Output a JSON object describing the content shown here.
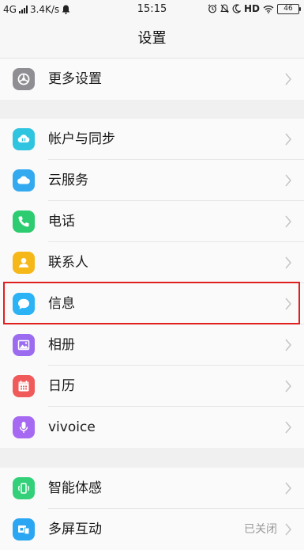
{
  "status_bar": {
    "network": "4G",
    "speed": "3.4K/s",
    "time": "15:15",
    "hd": "HD",
    "battery": "46"
  },
  "title": "设置",
  "groups": [
    {
      "items": [
        {
          "label": "更多设置",
          "icon": "gear-icon",
          "color": "#8e8e93"
        }
      ]
    },
    {
      "items": [
        {
          "label": "帐户与同步",
          "icon": "account-sync-icon",
          "color": "#2fc4e0"
        },
        {
          "label": "云服务",
          "icon": "cloud-icon",
          "color": "#33aaf0"
        },
        {
          "label": "电话",
          "icon": "phone-icon",
          "color": "#2dcc70"
        },
        {
          "label": "联系人",
          "icon": "contact-icon",
          "color": "#f6b819"
        },
        {
          "label": "信息",
          "icon": "message-icon",
          "color": "#2bb3f5"
        },
        {
          "label": "相册",
          "icon": "album-icon",
          "color": "#9b6cf0"
        },
        {
          "label": "日历",
          "icon": "calendar-icon",
          "color": "#f05a5a"
        },
        {
          "label": "vivoice",
          "icon": "microphone-icon",
          "color": "#a66af2"
        }
      ]
    },
    {
      "items": [
        {
          "label": "智能体感",
          "icon": "motion-sense-icon",
          "color": "#33d07a"
        },
        {
          "label": "多屏互动",
          "icon": "multi-screen-icon",
          "color": "#2aa6f2",
          "value": "已关闭"
        }
      ]
    }
  ]
}
